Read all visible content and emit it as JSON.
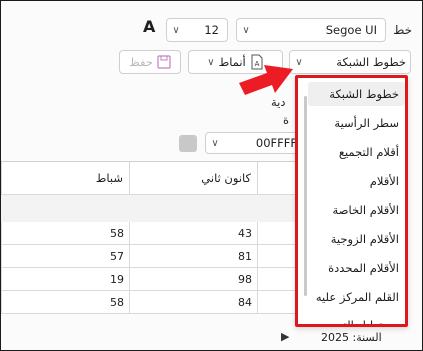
{
  "toolbar": {
    "font_label": "خط",
    "font_name": "Segoe UI",
    "font_size": "12",
    "font_size_icon": "A",
    "gridlines_combo": "خطوط الشبكة",
    "styles_button": "أنماط",
    "save_button": "حفظ"
  },
  "side_labels": {
    "label_1": "دية",
    "label_2": "ة"
  },
  "color": {
    "value": "00FFFF",
    "swatch": "#c8c8c8"
  },
  "grid": {
    "columns": [
      "شباط",
      "كانون ثاني",
      ""
    ],
    "rows": [
      [
        "58",
        "43",
        ""
      ],
      [
        "57",
        "81",
        ""
      ],
      [
        "19",
        "98",
        ""
      ],
      [
        "58",
        "84",
        ""
      ]
    ],
    "footer": "السنة: 2025"
  },
  "dropdown": {
    "items": [
      "خطوط الشبكة",
      "سطر الرأسية",
      "أقلام التجميع",
      "الأقلام",
      "الأقلام الخاصة",
      "الأقلام الزوجية",
      "الأقلام المحددة",
      "القلم المركز عليه",
      "مستطيل التحديد"
    ],
    "selected_index": 0
  },
  "colors": {
    "highlight": "#e0161d",
    "arrow": "#ec1c24"
  }
}
